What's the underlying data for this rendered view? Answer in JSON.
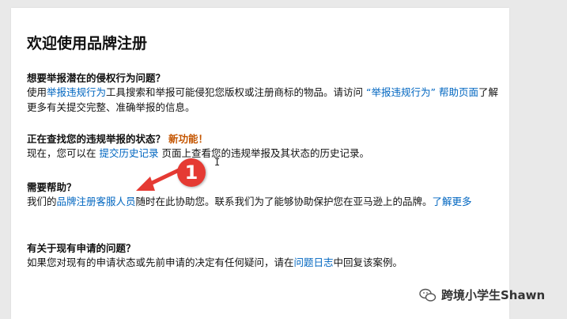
{
  "page": {
    "title": "欢迎使用品牌注册"
  },
  "sections": [
    {
      "heading": "想要举报潜在的侵权行为问题？",
      "body": [
        {
          "text": "使用",
          "link": false
        },
        {
          "text": "举报违规行为",
          "link": true
        },
        {
          "text": "工具搜索和举报可能侵犯您版权或注册商标的物品。请访问 ",
          "link": false
        },
        {
          "text": "“举报违规行为” 帮助页面",
          "link": true
        },
        {
          "text": "了解更多有关提交完整、准确举报的信息。",
          "link": false
        }
      ]
    },
    {
      "heading": "正在查找您的违规举报的状态？",
      "badge": "新功能！",
      "body": [
        {
          "text": "现在，您可以在 ",
          "link": false
        },
        {
          "text": "提交历史记录",
          "link": true
        },
        {
          "text": " 页面上查看您的违规举报及其状态的历史记录。",
          "link": false
        }
      ]
    },
    {
      "heading": "需要帮助？",
      "body": [
        {
          "text": "我们的",
          "link": false
        },
        {
          "text": "品牌注册客服人员",
          "link": true
        },
        {
          "text": "随时在此协助您。联系我们为了能够协助保护您在亚马逊上的品牌。",
          "link": false
        },
        {
          "text": "了解更多",
          "link": true
        }
      ]
    },
    {
      "heading": "有关于现有申请的问题？",
      "body": [
        {
          "text": "如果您对现有的申请状态或先前申请的决定有任何疑问，请在",
          "link": false
        },
        {
          "text": "问题日志",
          "link": true
        },
        {
          "text": "中回复该案例。",
          "link": false
        }
      ]
    }
  ],
  "annotation": {
    "number": "1",
    "color": "#e53a33"
  },
  "cursor": {
    "glyph": "I"
  },
  "watermark": {
    "text": "跨境小学生Shawn",
    "icon": "wechat-icon"
  },
  "colors": {
    "link": "#0066c0",
    "new_badge": "#c45500",
    "text": "#111111"
  }
}
